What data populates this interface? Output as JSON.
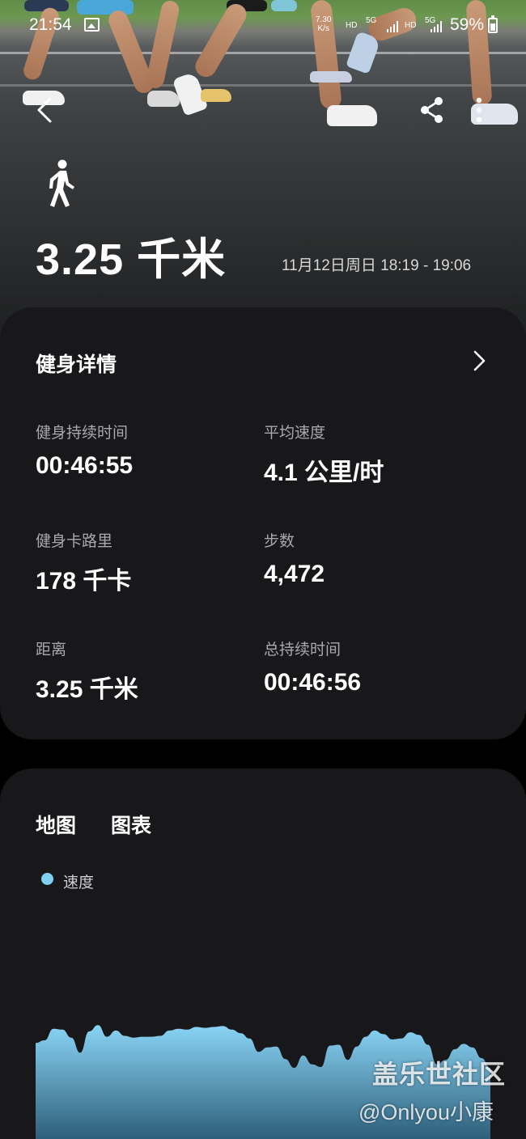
{
  "status_bar": {
    "time": "21:54",
    "net_speed_value": "7.30",
    "net_speed_unit": "K/s",
    "hd1": "HD",
    "g1": "5G",
    "hd2": "HD",
    "g2": "5G",
    "battery": "59%"
  },
  "icons": {
    "back": "back-arrow-icon",
    "share": "share-icon",
    "more": "more-vert-icon",
    "activity": "walking-icon",
    "details_chevron": "chevron-right-icon"
  },
  "header": {
    "distance": "3.25 千米",
    "date_range": "11月12日周日 18:19 - 19:06"
  },
  "details": {
    "title": "健身详情",
    "metrics": [
      {
        "label": "健身持续时间",
        "value": "00:46:55"
      },
      {
        "label": "平均速度",
        "value": "4.1 公里/时"
      },
      {
        "label": "健身卡路里",
        "value": "178 千卡"
      },
      {
        "label": "步数",
        "value": "4,472"
      },
      {
        "label": "距离",
        "value": "3.25 千米"
      },
      {
        "label": "总持续时间",
        "value": "00:46:56"
      }
    ]
  },
  "chart_section": {
    "tabs": [
      "地图",
      "图表"
    ],
    "legend": "速度",
    "colors": {
      "series": "#7fd0f3",
      "fill_top": "#8ad4f5",
      "fill_bottom": "#2d5f7a"
    }
  },
  "chart_data": {
    "type": "area",
    "title": "",
    "xlabel": "",
    "ylabel": "",
    "series": [
      {
        "name": "速度",
        "values": [
          0.37,
          0.4,
          0.53,
          0.52,
          0.43,
          0.26,
          0.5,
          0.57,
          0.44,
          0.51,
          0.45,
          0.43,
          0.44,
          0.44,
          0.45,
          0.51,
          0.53,
          0.52,
          0.55,
          0.54,
          0.55,
          0.56,
          0.52,
          0.48,
          0.42,
          0.27,
          0.32,
          0.33,
          0.19,
          0.09,
          0.23,
          0.13,
          0.1,
          0.34,
          0.35,
          0.18,
          0.33,
          0.44,
          0.51,
          0.47,
          0.41,
          0.42,
          0.49,
          0.46,
          0.35,
          0.13,
          0.18,
          0.3,
          0.36,
          0.32,
          0.2,
          0.09
        ]
      }
    ]
  },
  "watermark": {
    "line1": "盖乐世社区",
    "line2": "@Onlyou小康"
  }
}
